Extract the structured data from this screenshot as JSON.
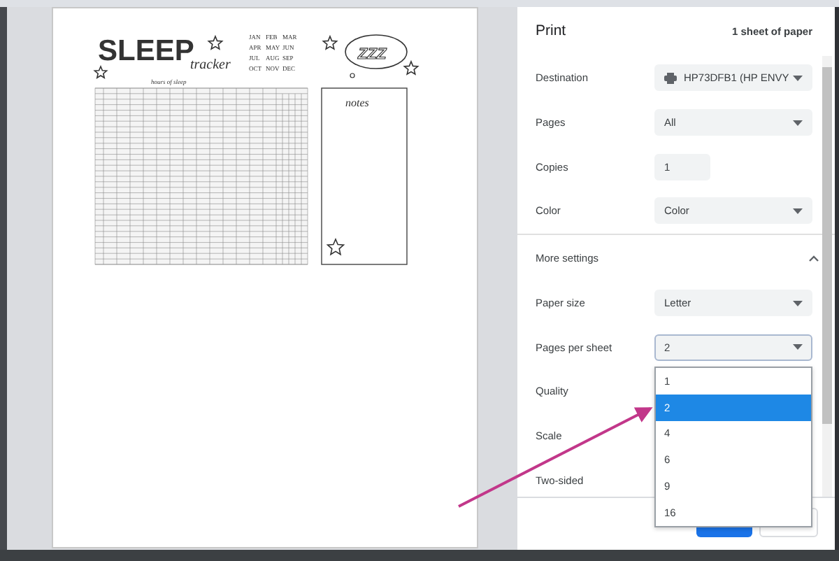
{
  "preview": {
    "title": "SLEEP",
    "subtitle": "tracker",
    "caption": "hours of sleep",
    "months": [
      "JAN",
      "FEB",
      "MAR",
      "APR",
      "MAY",
      "JUN",
      "JUL",
      "AUG",
      "SEP",
      "OCT",
      "NOV",
      "DEC"
    ],
    "cloud_text": "ZZZ",
    "notes_title": "notes"
  },
  "panel": {
    "title": "Print",
    "summary": "1 sheet of paper",
    "settings": [
      {
        "kind": "destination",
        "label": "Destination",
        "value": "HP73DFB1 (HP ENVY"
      },
      {
        "kind": "select",
        "label": "Pages",
        "value": "All"
      },
      {
        "kind": "number",
        "label": "Copies",
        "value": "1"
      },
      {
        "kind": "select",
        "label": "Color",
        "value": "Color"
      },
      {
        "kind": "section",
        "label": "More settings",
        "expanded": true
      },
      {
        "kind": "select",
        "label": "Paper size",
        "value": "Letter"
      },
      {
        "kind": "select",
        "label": "Pages per sheet",
        "value": "2",
        "open": true,
        "options": [
          {
            "label": "1",
            "selected": false
          },
          {
            "label": "2",
            "selected": true
          },
          {
            "label": "4",
            "selected": false
          },
          {
            "label": "6",
            "selected": false
          },
          {
            "label": "9",
            "selected": false
          },
          {
            "label": "16",
            "selected": false
          }
        ]
      },
      {
        "kind": "covered",
        "label": "Quality"
      },
      {
        "kind": "covered",
        "label": "Scale"
      },
      {
        "kind": "covered",
        "label": "Two-sided"
      }
    ],
    "footer_buttons": [
      {
        "kind": "primary"
      },
      {
        "kind": "secondary"
      }
    ]
  }
}
